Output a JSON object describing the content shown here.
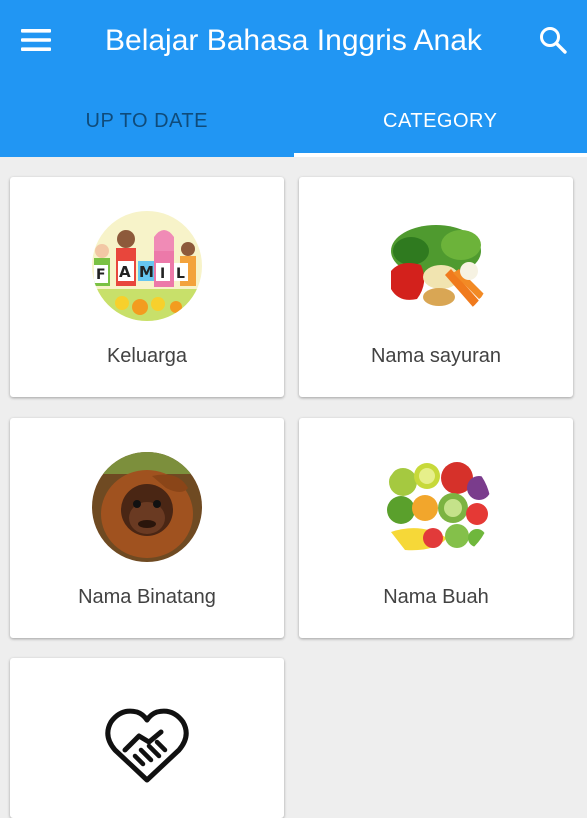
{
  "toolbar": {
    "menu_icon": "menu-icon",
    "title": "Belajar Bahasa Inggris Anak",
    "search_icon": "search-icon"
  },
  "tabs": [
    {
      "label": "UP TO DATE",
      "selected": false
    },
    {
      "label": "CATEGORY",
      "selected": true
    }
  ],
  "categories": [
    {
      "label": "Keluarga",
      "image": "family-image"
    },
    {
      "label": "Nama sayuran",
      "image": "vegetables-image"
    },
    {
      "label": "Nama Binatang",
      "image": "orangutan-image"
    },
    {
      "label": "Nama Buah",
      "image": "fruits-image"
    },
    {
      "label": "",
      "image": "handshake-heart-icon"
    }
  ],
  "colors": {
    "primary": "#2196f3",
    "background": "#eeeeee",
    "card": "#ffffff",
    "inactive_tab_text": "#0d3f66"
  }
}
